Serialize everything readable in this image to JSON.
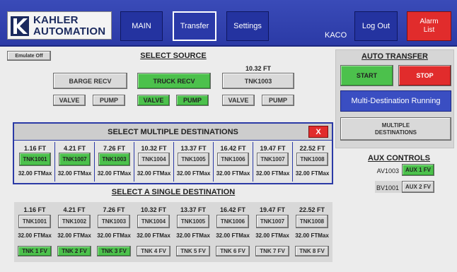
{
  "header": {
    "logo_line1": "KAHLER",
    "logo_line2": "AUTOMATION",
    "nav": [
      {
        "label": "MAIN"
      },
      {
        "label": "Transfer"
      },
      {
        "label": "Settings"
      }
    ],
    "station": "KACO",
    "logout": "Log Out",
    "alarm_line1": "Alarm",
    "alarm_line2": "List"
  },
  "emulate_label": "Emulate Off",
  "source": {
    "title": "SELECT SOURCE",
    "barge": {
      "label": "BARGE RECV",
      "valve": "VALVE",
      "pump": "PUMP"
    },
    "truck": {
      "label": "TRUCK RECV",
      "valve": "VALVE",
      "pump": "PUMP"
    },
    "tank": {
      "level": "10.32 FT",
      "label": "TNK1003",
      "valve": "VALVE",
      "pump": "PUMP"
    }
  },
  "auto_transfer": {
    "title": "AUTO TRANSFER",
    "start": "START",
    "stop": "STOP",
    "status": "Multi-Destination Running",
    "multiple_line1": "MULTIPLE",
    "multiple_line2": "DESTINATIONS"
  },
  "multi": {
    "title": "SELECT MULTIPLE DESTINATIONS",
    "close": "X",
    "tanks": [
      {
        "level": "1.16 FT",
        "name": "TNK1001",
        "max": "32.00 FTMax",
        "selected": true
      },
      {
        "level": "4.21 FT",
        "name": "TNK1007",
        "max": "32.00 FTMax",
        "selected": true
      },
      {
        "level": "7.26 FT",
        "name": "TNK1003",
        "max": "32.00 FTMax",
        "selected": true
      },
      {
        "level": "10.32 FT",
        "name": "TNK1004",
        "max": "32.00 FTMax",
        "selected": false
      },
      {
        "level": "13.37 FT",
        "name": "TNK1005",
        "max": "32.00 FTMax",
        "selected": false
      },
      {
        "level": "16.42 FT",
        "name": "TNK1006",
        "max": "32.00 FTMax",
        "selected": false
      },
      {
        "level": "19.47 FT",
        "name": "TNK1007",
        "max": "32.00 FTMax",
        "selected": false
      },
      {
        "level": "22.52 FT",
        "name": "TNK1008",
        "max": "32.00 FTMax",
        "selected": false
      }
    ]
  },
  "aux": {
    "title": "AUX CONTROLS",
    "row1": {
      "label": "AV1003",
      "button": "AUX 1 FV"
    },
    "row2": {
      "label": "BV1001",
      "button": "AUX 2 FV"
    }
  },
  "single": {
    "title": "SELECT A SINGLE DESTINATION",
    "tanks": [
      {
        "level": "1.16 FT",
        "name": "TNK1001",
        "max": "32.00 FTMax",
        "fv": "TNK 1 FV",
        "fv_on": true
      },
      {
        "level": "4.21 FT",
        "name": "TNK1002",
        "max": "32.00 FTMax",
        "fv": "TNK 2 FV",
        "fv_on": true
      },
      {
        "level": "7.26 FT",
        "name": "TNK1003",
        "max": "32.00 FTMax",
        "fv": "TNK 3 FV",
        "fv_on": true
      },
      {
        "level": "10.32 FT",
        "name": "TNK1004",
        "max": "32.00 FTMax",
        "fv": "TNK 4 FV",
        "fv_on": false
      },
      {
        "level": "13.37 FT",
        "name": "TNK1005",
        "max": "32.00 FTMax",
        "fv": "TNK 5 FV",
        "fv_on": false
      },
      {
        "level": "16.42 FT",
        "name": "TNK1006",
        "max": "32.00 FTMax",
        "fv": "TNK 6 FV",
        "fv_on": false
      },
      {
        "level": "19.47 FT",
        "name": "TNK1007",
        "max": "32.00 FTMax",
        "fv": "TNK 7 FV",
        "fv_on": false
      },
      {
        "level": "22.52 FT",
        "name": "TNK1008",
        "max": "32.00 FTMax",
        "fv": "TNK 8 FV",
        "fv_on": false
      }
    ]
  },
  "colors": {
    "header": "#2b3aa6",
    "green": "#4cc14c",
    "red": "#e12c2c"
  }
}
